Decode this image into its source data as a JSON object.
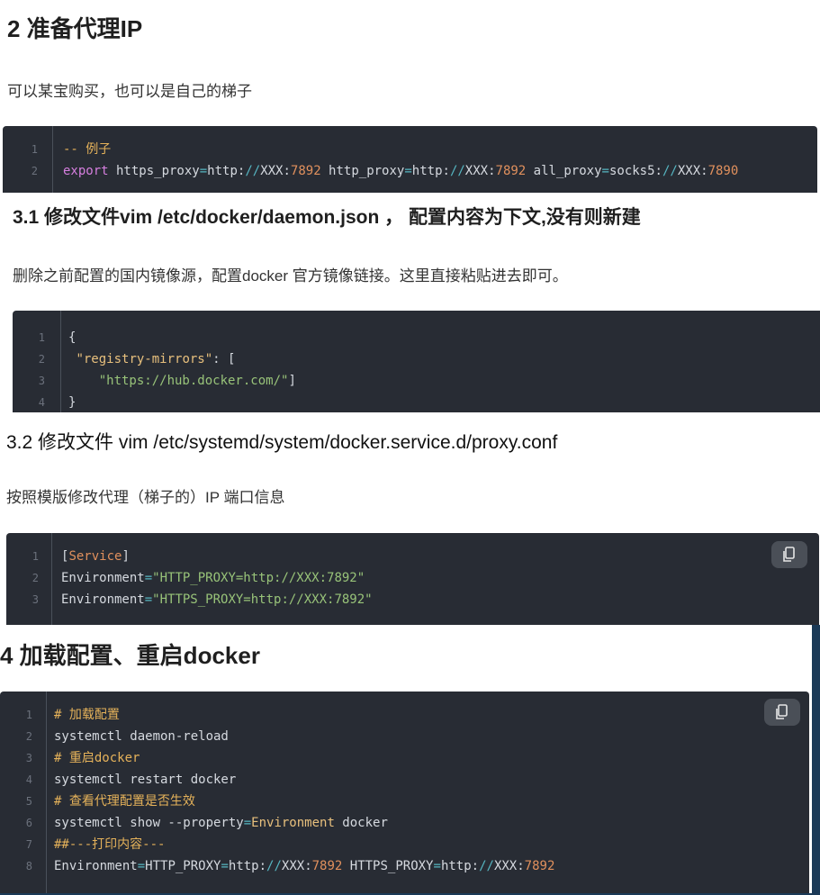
{
  "section1": {
    "heading": "2 准备代理IP",
    "description": "可以某宝购买，也可以是自己的梯子",
    "code": {
      "line_numbers": [
        "1",
        "2"
      ],
      "lines": [
        [
          {
            "c": "cm",
            "t": "-- 例子"
          }
        ],
        [
          {
            "c": "kw",
            "t": "export"
          },
          {
            "c": "",
            "t": " https_proxy"
          },
          {
            "c": "op",
            "t": "="
          },
          {
            "c": "",
            "t": "http:"
          },
          {
            "c": "op",
            "t": "//"
          },
          {
            "c": "",
            "t": "XXX:"
          },
          {
            "c": "num",
            "t": "7892"
          },
          {
            "c": "",
            "t": " http_proxy"
          },
          {
            "c": "op",
            "t": "="
          },
          {
            "c": "",
            "t": "http:"
          },
          {
            "c": "op",
            "t": "//"
          },
          {
            "c": "",
            "t": "XXX:"
          },
          {
            "c": "num",
            "t": "7892"
          },
          {
            "c": "",
            "t": " all_proxy"
          },
          {
            "c": "op",
            "t": "="
          },
          {
            "c": "",
            "t": "socks5:"
          },
          {
            "c": "op",
            "t": "//"
          },
          {
            "c": "",
            "t": "XXX:"
          },
          {
            "c": "num",
            "t": "7890"
          }
        ]
      ]
    }
  },
  "section2": {
    "heading": "3.1 修改文件vim /etc/docker/daemon.json ， 配置内容为下文,没有则新建",
    "description": "删除之前配置的国内镜像源，配置docker 官方镜像链接。这里直接粘贴进去即可。",
    "code": {
      "line_numbers": [
        "1",
        "2",
        "3",
        "4"
      ],
      "lines": [
        [
          {
            "c": "",
            "t": "{"
          }
        ],
        [
          {
            "c": "",
            "t": " "
          },
          {
            "c": "key",
            "t": "\"registry-mirrors\""
          },
          {
            "c": "",
            "t": ": ["
          }
        ],
        [
          {
            "c": "",
            "t": "    "
          },
          {
            "c": "str",
            "t": "\"https://hub.docker.com/\""
          },
          {
            "c": "",
            "t": "]"
          }
        ],
        [
          {
            "c": "",
            "t": "}"
          }
        ]
      ]
    }
  },
  "section3": {
    "heading": "3.2 修改文件 vim /etc/systemd/system/docker.service.d/proxy.conf",
    "description": "按照模版修改代理（梯子的）IP 端口信息",
    "code": {
      "line_numbers": [
        "1",
        "2",
        "3"
      ],
      "lines": [
        [
          {
            "c": "",
            "t": "["
          },
          {
            "c": "num",
            "t": "Service"
          },
          {
            "c": "",
            "t": "]"
          }
        ],
        [
          {
            "c": "",
            "t": "Environment"
          },
          {
            "c": "op",
            "t": "="
          },
          {
            "c": "str",
            "t": "\"HTTP_PROXY=http://XXX:7892\""
          }
        ],
        [
          {
            "c": "",
            "t": "Environment"
          },
          {
            "c": "op",
            "t": "="
          },
          {
            "c": "str",
            "t": "\"HTTPS_PROXY=http://XXX:7892\""
          }
        ]
      ]
    }
  },
  "section4": {
    "heading": "4 加载配置、重启docker",
    "code": {
      "line_numbers": [
        "1",
        "2",
        "3",
        "4",
        "5",
        "6",
        "7",
        "8"
      ],
      "lines": [
        [
          {
            "c": "cm",
            "t": "# 加载配置"
          }
        ],
        [
          {
            "c": "",
            "t": "systemctl daemon-reload"
          }
        ],
        [
          {
            "c": "cm",
            "t": "# 重启docker"
          }
        ],
        [
          {
            "c": "",
            "t": "systemctl restart docker"
          }
        ],
        [
          {
            "c": "cm",
            "t": "# 查看代理配置是否生效"
          }
        ],
        [
          {
            "c": "",
            "t": "systemctl show --property"
          },
          {
            "c": "op",
            "t": "="
          },
          {
            "c": "key",
            "t": "Environment"
          },
          {
            "c": "",
            "t": " docker"
          }
        ],
        [
          {
            "c": "cm",
            "t": "##---打印内容---"
          }
        ],
        [
          {
            "c": "",
            "t": "Environment"
          },
          {
            "c": "op",
            "t": "="
          },
          {
            "c": "",
            "t": "HTTP_PROXY"
          },
          {
            "c": "op",
            "t": "="
          },
          {
            "c": "",
            "t": "http:"
          },
          {
            "c": "op",
            "t": "//"
          },
          {
            "c": "",
            "t": "XXX:"
          },
          {
            "c": "num",
            "t": "7892"
          },
          {
            "c": "",
            "t": " HTTPS_PROXY"
          },
          {
            "c": "op",
            "t": "="
          },
          {
            "c": "",
            "t": "http:"
          },
          {
            "c": "op",
            "t": "//"
          },
          {
            "c": "",
            "t": "XXX:"
          },
          {
            "c": "num",
            "t": "7892"
          }
        ]
      ]
    }
  },
  "icons": {
    "copy": "copy-icon"
  },
  "colors": {
    "code_bg": "#282c34",
    "comment": "#e5b25a",
    "keyword": "#d67fdf",
    "number": "#e0905d",
    "string": "#98c379"
  }
}
